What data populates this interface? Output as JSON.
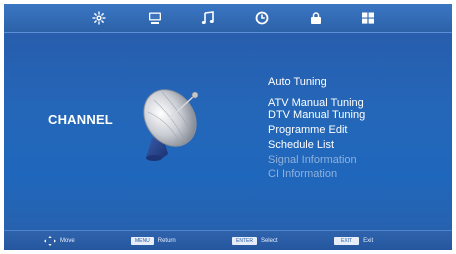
{
  "topbar": {
    "tabs": [
      {
        "icon": "picture-settings-icon"
      },
      {
        "icon": "channel-screen-icon"
      },
      {
        "icon": "sound-note-icon"
      },
      {
        "icon": "time-clock-icon"
      },
      {
        "icon": "lock-icon"
      },
      {
        "icon": "setup-grid-icon"
      }
    ]
  },
  "main": {
    "section_title": "CHANNEL",
    "menu_items": [
      {
        "label": "Auto Tuning",
        "enabled": true
      },
      {
        "label": "ATV Manual Tuning",
        "enabled": true
      },
      {
        "label": "DTV Manual Tuning",
        "enabled": true
      },
      {
        "label": "Programme Edit",
        "enabled": true
      },
      {
        "label": "Schedule List",
        "enabled": true
      },
      {
        "label": "Signal Information",
        "enabled": false
      },
      {
        "label": "CI Information",
        "enabled": false
      }
    ]
  },
  "footer": {
    "move": {
      "icon": "move-arrows-icon",
      "label": "Move"
    },
    "return": {
      "key": "MENU",
      "label": "Return"
    },
    "select": {
      "key": "ENTER",
      "label": "Select"
    },
    "exit": {
      "key": "EXIT",
      "label": "Exit"
    }
  },
  "colors": {
    "background": "#2467b9",
    "text": "#ffffff",
    "disabled_text": "#8fb0db"
  }
}
